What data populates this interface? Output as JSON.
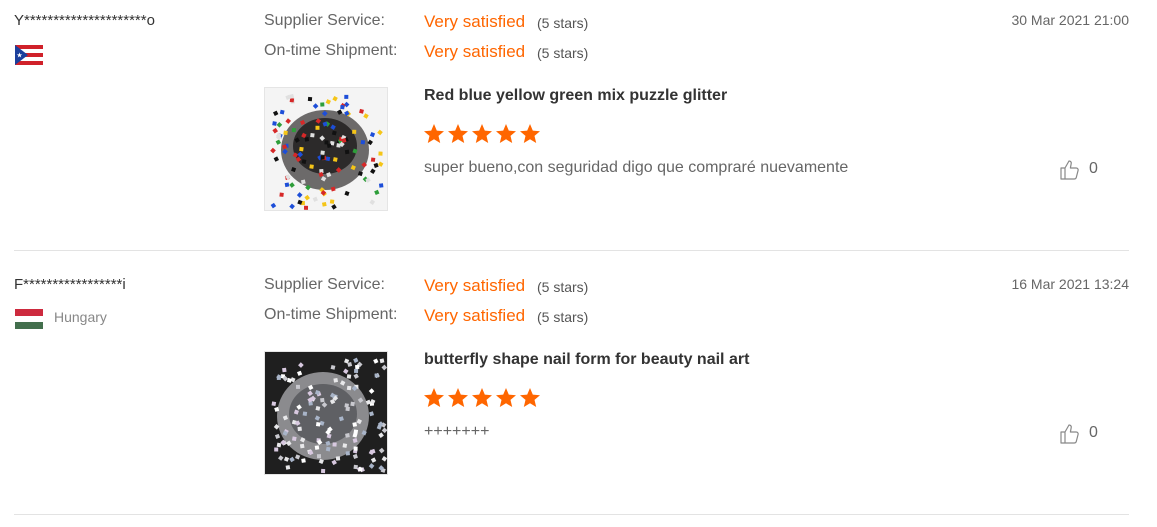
{
  "reviews": [
    {
      "buyer": "Y*********************o",
      "country": "",
      "flag": "puerto-rico",
      "date": "30 Mar 2021 21:00",
      "supplier_label": "Supplier Service:",
      "supplier_value": "Very satisfied",
      "supplier_stars": "(5 stars)",
      "shipment_label": "On-time Shipment:",
      "shipment_value": "Very satisfied",
      "shipment_stars": "(5 stars)",
      "product_title": "Red blue yellow green mix puzzle glitter",
      "rating": 5,
      "comment": "super bueno,con seguridad digo que compraré nuevamente",
      "helpful_count": "0"
    },
    {
      "buyer": "F*****************i",
      "country": "Hungary",
      "flag": "hungary",
      "date": "16 Mar 2021 13:24",
      "supplier_label": "Supplier Service:",
      "supplier_value": "Very satisfied",
      "supplier_stars": "(5 stars)",
      "shipment_label": "On-time Shipment:",
      "shipment_value": "Very satisfied",
      "shipment_stars": "(5 stars)",
      "product_title": "butterfly shape nail form for beauty nail art",
      "rating": 5,
      "comment": "+++++++",
      "helpful_count": "0"
    }
  ],
  "colors": {
    "accent": "#ff6600",
    "divider": "#e3e3e3"
  },
  "icons": {
    "like": "thumbs-up-icon",
    "star": "star-icon"
  }
}
